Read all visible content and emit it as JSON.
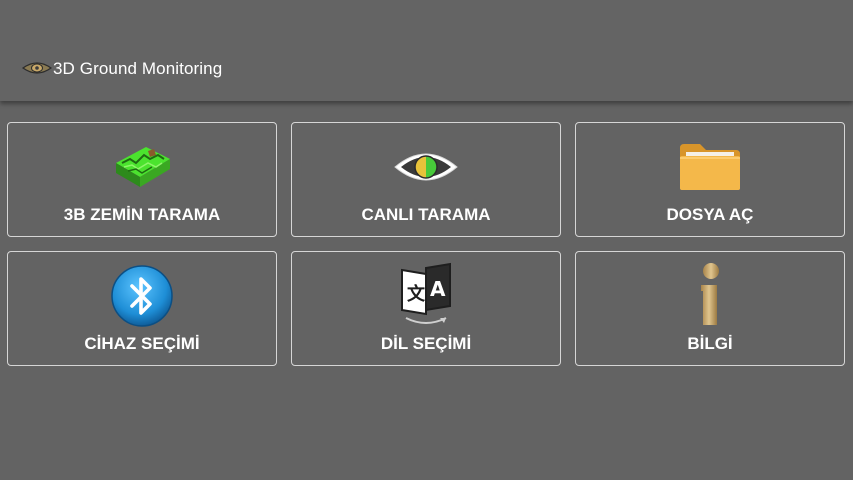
{
  "app": {
    "title": "3D Ground Monitoring",
    "icon": "eye-logo-icon"
  },
  "menu": {
    "items": [
      {
        "label": "3B ZEMİN TARAMA",
        "icon": "terrain-3d-icon"
      },
      {
        "label": "CANLI TARAMA",
        "icon": "eye-icon"
      },
      {
        "label": "DOSYA AÇ",
        "icon": "folder-icon"
      },
      {
        "label": "CİHAZ SEÇİMİ",
        "icon": "bluetooth-icon"
      },
      {
        "label": "DİL SEÇİMİ",
        "icon": "translate-icon"
      },
      {
        "label": "BİLGİ",
        "icon": "info-icon"
      }
    ]
  },
  "colors": {
    "background": "#636363",
    "tile_border": "#d6d6d6",
    "text": "#ffffff",
    "folder": "#f4b84a",
    "bluetooth": "#1e8ed6",
    "info": "#c9a868",
    "terrain": "#3bcf2a"
  }
}
